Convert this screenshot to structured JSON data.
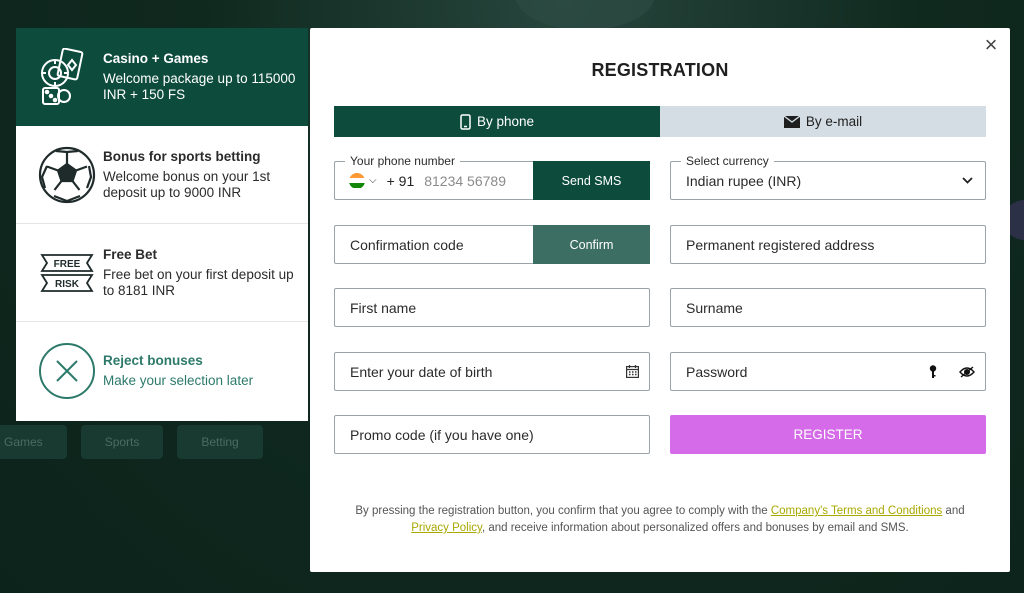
{
  "background": {
    "nav": [
      "Games",
      "Sports",
      "Betting"
    ]
  },
  "bonuses": [
    {
      "icon": "casino-chips-icon",
      "title": "Casino + Games",
      "desc": "Welcome package up to 115000 INR + 150 FS",
      "active": true
    },
    {
      "icon": "soccer-ball-icon",
      "title": "Bonus for sports betting",
      "desc": "Welcome bonus on your 1st deposit up to 9000 INR",
      "active": false
    },
    {
      "icon": "free-risk-icon",
      "title": "Free Bet",
      "desc": "Free bet on your first deposit up to 8181 INR",
      "active": false,
      "icon_text": [
        "FREE",
        "RISK"
      ]
    },
    {
      "icon": "close-circle-icon",
      "title": "Reject bonuses",
      "desc": "Make your selection later",
      "active": false
    }
  ],
  "modal": {
    "title": "REGISTRATION",
    "close": "×",
    "tabs": [
      {
        "label": "By phone",
        "icon": "phone-icon",
        "active": true
      },
      {
        "label": "By e-mail",
        "icon": "envelope-icon",
        "active": false
      }
    ],
    "phone": {
      "label": "Your phone number",
      "prefix": "+ 91",
      "placeholder": "81234 56789",
      "send_sms": "Send SMS"
    },
    "currency": {
      "label": "Select currency",
      "value": "Indian rupee (INR)"
    },
    "confirmation": {
      "placeholder": "Confirmation code",
      "button": "Confirm"
    },
    "address": "Permanent registered address",
    "first_name": "First name",
    "surname": "Surname",
    "dob": "Enter your date of birth",
    "password": "Password",
    "promo": "Promo code (if you have one)",
    "register": "REGISTER",
    "legal": {
      "part1": "By pressing the registration button, you confirm that you agree to comply with the ",
      "terms_link": "Company's Terms and Conditions",
      "part2": " and ",
      "privacy_link": "Privacy Policy",
      "part3": ", and receive information about personalized offers and bonuses by email and SMS."
    }
  },
  "colors": {
    "primary": "#0d4c3d",
    "register": "#d56be8",
    "link": "#a8a800"
  }
}
